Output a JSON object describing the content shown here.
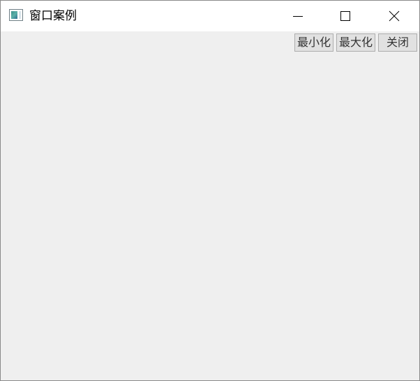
{
  "window": {
    "title": "窗口案例",
    "icon": "app-window-icon"
  },
  "titlebar_controls": {
    "minimize_icon": "minimize-icon",
    "maximize_icon": "maximize-icon",
    "close_icon": "close-icon"
  },
  "buttons": {
    "minimize_label": "最小化",
    "maximize_label": "最大化",
    "close_label": "关闭"
  },
  "colors": {
    "client_background": "#efefef",
    "titlebar_background": "#ffffff",
    "button_background": "#e1e1e1",
    "button_border": "#adadad"
  }
}
